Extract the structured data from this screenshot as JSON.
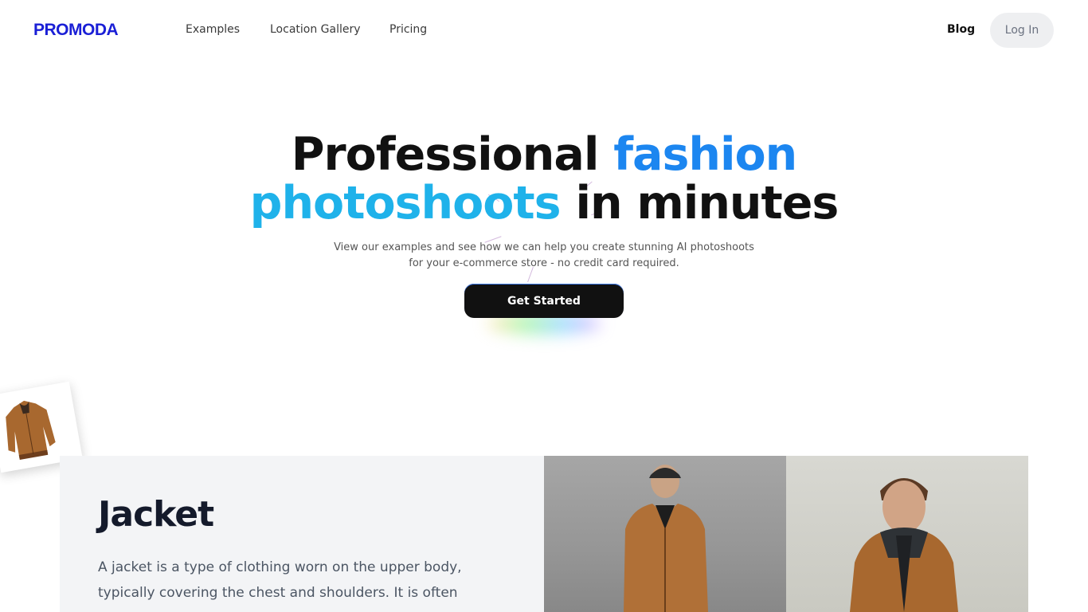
{
  "brand": {
    "logo": "PROMODA"
  },
  "nav": {
    "links": [
      "Examples",
      "Location Gallery",
      "Pricing"
    ],
    "blog": "Blog",
    "login": "Log In"
  },
  "hero": {
    "title_part1": "Professional ",
    "title_highlight1": "fashion",
    "title_highlight2": "photoshoots",
    "title_part2": " in minutes",
    "subtitle_line1": "View our examples and see how we can help you create stunning AI photoshoots",
    "subtitle_line2": "for your e-commerce store - no credit card required.",
    "cta": "Get Started"
  },
  "product": {
    "title": "Jacket",
    "description": "A jacket is a type of clothing worn on the upper body, typically covering the chest and shoulders. It is often made"
  },
  "colors": {
    "brand_blue": "#1a1fd6",
    "accent_blue": "#1c86f0",
    "accent_cyan": "#1fb2ea",
    "cta_bg": "#111111",
    "section_bg": "#f3f4f6"
  },
  "icons": {
    "jacket_thumbnail": "jacket-product-icon"
  }
}
